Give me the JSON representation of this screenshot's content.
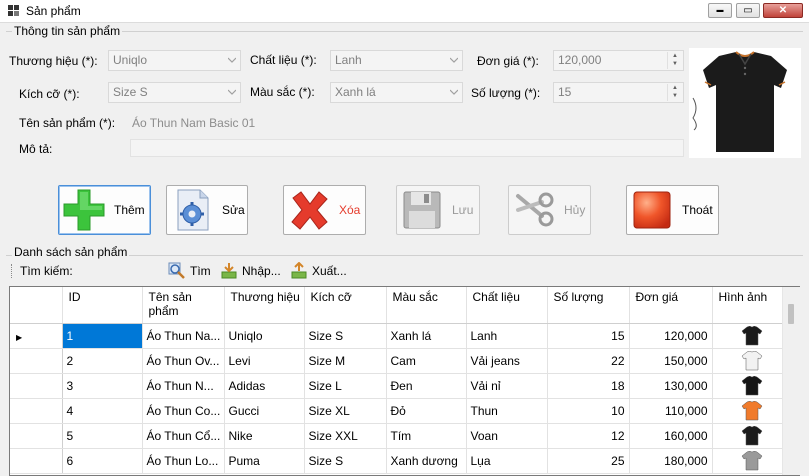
{
  "window": {
    "title": "Sản phẩm",
    "minimize_symbol": "▬",
    "maximize_symbol": "▭",
    "close_symbol": "✕"
  },
  "product_info": {
    "caption": "Thông tin sản phẩm",
    "brand": {
      "label": "Thương hiệu (*):",
      "value": "Uniqlo"
    },
    "material": {
      "label": "Chất liệu (*):",
      "value": "Lanh"
    },
    "unit_price": {
      "label": "Đơn giá (*):",
      "value": "120,000"
    },
    "size": {
      "label": "Kích cỡ (*):",
      "value": "Size S"
    },
    "color": {
      "label": "Màu sắc (*):",
      "value": "Xanh lá"
    },
    "quantity": {
      "label": "Số lượng (*):",
      "value": "15"
    },
    "product_name": {
      "label": "Tên sản phẩm (*):",
      "value": "Áo Thun Nam Basic 01"
    },
    "description": {
      "label": "Mô tả:",
      "value": ""
    },
    "image_icon": "polo-shirt-image"
  },
  "actions": {
    "add": {
      "label": "Thêm",
      "icon": "plus-icon"
    },
    "edit": {
      "label": "Sửa",
      "icon": "gear-document-icon"
    },
    "delete": {
      "label": "Xóa",
      "icon": "x-icon"
    },
    "save": {
      "label": "Lưu",
      "icon": "floppy-disk-icon"
    },
    "cancel": {
      "label": "Hủy",
      "icon": "scissors-icon"
    },
    "exit": {
      "label": "Thoát",
      "icon": "exit-square-icon"
    }
  },
  "product_list": {
    "caption": "Danh sách sản phẩm",
    "search_label": "Tìm kiếm:",
    "search_button": "Tìm",
    "import_button": "Nhập...",
    "export_button": "Xuất...",
    "columns": [
      "ID",
      "Tên sản phẩm",
      "Thương hiệu",
      "Kích cỡ",
      "Màu sắc",
      "Chất liệu",
      "Số lượng",
      "Đơn giá",
      "Hình ảnh"
    ],
    "rows": [
      {
        "id": "1",
        "name": "Áo Thun Na...",
        "brand": "Uniqlo",
        "size": "Size S",
        "color": "Xanh lá",
        "material": "Lanh",
        "qty": "15",
        "price": "120,000",
        "shirt_color": "#1a1a1a"
      },
      {
        "id": "2",
        "name": "Áo Thun Ov...",
        "brand": "Levi",
        "size": "Size M",
        "color": "Cam",
        "material": "Vải jeans",
        "qty": "22",
        "price": "150,000",
        "shirt_color": "#f2f2f2"
      },
      {
        "id": "3",
        "name": "Áo Thun N...",
        "brand": "Adidas",
        "size": "Size L",
        "color": "Đen",
        "material": "Vải nỉ",
        "qty": "18",
        "price": "130,000",
        "shirt_color": "#151515"
      },
      {
        "id": "4",
        "name": "Áo Thun Co...",
        "brand": "Gucci",
        "size": "Size XL",
        "color": "Đỏ",
        "material": "Thun",
        "qty": "10",
        "price": "110,000",
        "shirt_color": "#f07b2c"
      },
      {
        "id": "5",
        "name": "Áo Thun Cổ...",
        "brand": "Nike",
        "size": "Size XXL",
        "color": "Tím",
        "material": "Voan",
        "qty": "12",
        "price": "160,000",
        "shirt_color": "#1c1c1c"
      },
      {
        "id": "6",
        "name": "Áo Thun Lo...",
        "brand": "Puma",
        "size": "Size S",
        "color": "Xanh dương",
        "material": "Lụa",
        "qty": "25",
        "price": "180,000",
        "shirt_color": "#9a9a9a"
      }
    ],
    "current_row_marker": "▶"
  },
  "colors": {
    "selection": "#0078d7",
    "add_green": "#3cc43c",
    "delete_red": "#e53b2c",
    "exit_orange": "#f0562a"
  }
}
